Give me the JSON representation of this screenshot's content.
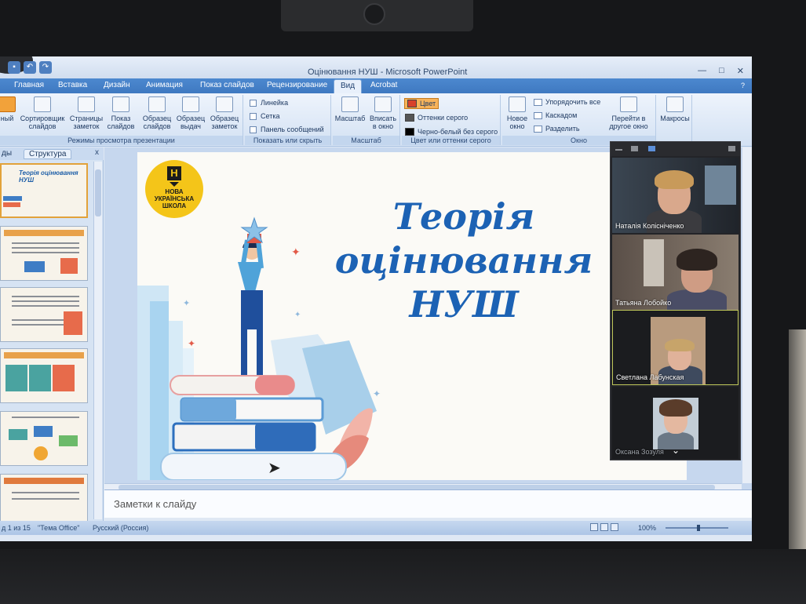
{
  "window": {
    "title": "Оцінювання НУШ - Microsoft PowerPoint"
  },
  "ribbon": {
    "tabs": [
      "Главная",
      "Вставка",
      "Дизайн",
      "Анимация",
      "Показ слайдов",
      "Рецензирование",
      "Вид",
      "Acrobat"
    ],
    "active_tab": "Вид",
    "views": {
      "label": "Режимы просмотра презентации",
      "normal": "ный",
      "sorter": "Сортировщик слайдов",
      "notes_page": "Страницы заметок",
      "slideshow": "Показ слайдов",
      "slide_master": "Образец слайдов",
      "handout_master": "Образец выдач",
      "notes_master": "Образец заметок"
    },
    "show_hide": {
      "label": "Показать или скрыть",
      "ruler": "Линейка",
      "grid": "Сетка",
      "message_bar": "Панель сообщений"
    },
    "zoom": {
      "label": "Масштаб",
      "zoom": "Масштаб",
      "fit": "Вписать в окно"
    },
    "color": {
      "label": "Цвет или оттенки серого",
      "color": "Цвет",
      "grayscale": "Оттенки серого",
      "bw": "Черно-белый без серого"
    },
    "window_group": {
      "label": "Окно",
      "new_window": "Новое окно",
      "arrange": "Упорядочить все",
      "cascade": "Каскадом",
      "split": "Разделить",
      "switch": "Перейти в другое окно"
    },
    "macros": {
      "label": "Макросы"
    }
  },
  "left_pane": {
    "tab_slides": "ды",
    "tab_outline": "Структура",
    "close": "x",
    "thumb1_title": "Теорія оцінювання НУШ"
  },
  "slide": {
    "logo_letter": "Н",
    "logo_text": "НОВА\nУКРАЇНСЬКА\nШКОЛА",
    "title": "Теорія оцінювання\nНУШ"
  },
  "notes": {
    "placeholder": "Заметки к слайду"
  },
  "status": {
    "slide_counter": "д 1 из 15",
    "theme": "\"Тема Office\"",
    "language": "Русский (Россия)",
    "zoom": "100%"
  },
  "conference": {
    "participants": [
      {
        "name": "Наталія Колісніченко"
      },
      {
        "name": "Татьяна Лобойко"
      },
      {
        "name": "Светлана Лабунская"
      },
      {
        "name": "Оксана Зозуля"
      }
    ],
    "more": "⌄"
  },
  "colors": {
    "accent": "#3e78c0",
    "title_blue": "#1c62b4",
    "logo_yellow": "#f4c519"
  }
}
